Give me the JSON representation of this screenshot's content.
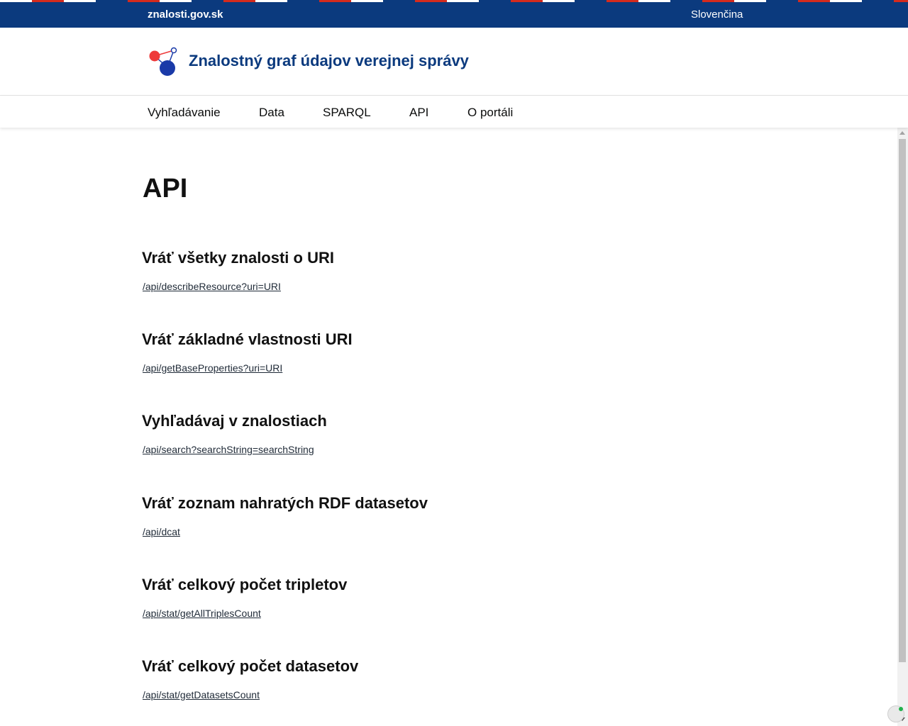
{
  "gov_bar": {
    "domain": "znalosti.gov.sk",
    "language": "Slovenčina"
  },
  "header": {
    "title": "Znalostný graf údajov verejnej správy",
    "logo_icon": "graph-nodes-icon"
  },
  "nav": {
    "items": [
      {
        "label": "Vyhľadávanie"
      },
      {
        "label": "Data"
      },
      {
        "label": "SPARQL"
      },
      {
        "label": "API"
      },
      {
        "label": "O portáli"
      }
    ]
  },
  "main": {
    "title": "API",
    "sections": [
      {
        "heading": "Vráť všetky znalosti o URI",
        "link": "/api/describeResource?uri=URI"
      },
      {
        "heading": "Vráť základné vlastnosti URI",
        "link": "/api/getBaseProperties?uri=URI"
      },
      {
        "heading": "Vyhľadávaj v znalostiach",
        "link": "/api/search?searchString=searchString"
      },
      {
        "heading": "Vráť zoznam nahratých RDF datasetov",
        "link": "/api/dcat"
      },
      {
        "heading": "Vráť celkový počet tripletov",
        "link": "/api/stat/getAllTriplesCount"
      },
      {
        "heading": "Vráť celkový počet datasetov",
        "link": "/api/stat/getDatasetsCount"
      }
    ]
  },
  "colors": {
    "gov_blue": "#0b3a7e",
    "flag_red": "#d52b1e",
    "logo_red": "#ee3a3a",
    "logo_blue": "#1a3aa8"
  }
}
